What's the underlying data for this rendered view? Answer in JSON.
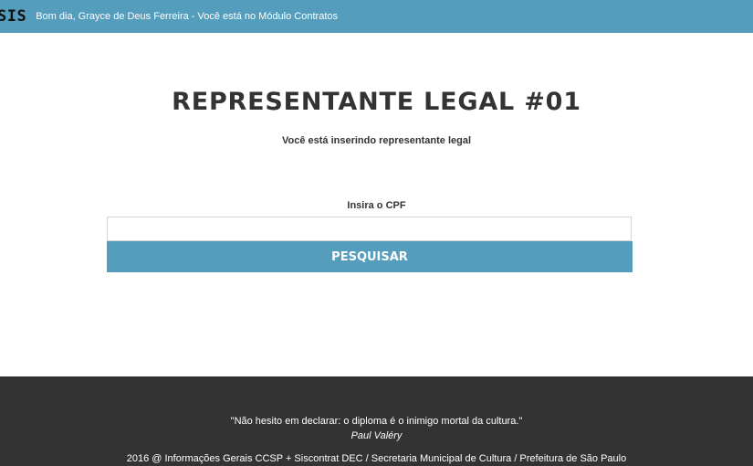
{
  "header": {
    "logo": "SIS",
    "greeting": "Bom dia, Grayce de Deus Ferreira - Você está no Módulo Contratos"
  },
  "main": {
    "title": "REPRESENTANTE LEGAL #01",
    "subtitle": "Você está inserindo representante legal",
    "cpf_label": "Insira o CPF",
    "cpf_value": "",
    "search_label": "PESQUISAR"
  },
  "footer": {
    "quote": "\"Não hesito em declarar: o diploma é o inimigo mortal da cultura.\"",
    "author": "Paul Valéry",
    "copyright": "2016 @ Informações Gerais CCSP + Siscontrat DEC / Secretaria Municipal de Cultura / Prefeitura de São Paulo"
  },
  "colors": {
    "accent": "#549dbd",
    "footer_bg": "#333333"
  }
}
